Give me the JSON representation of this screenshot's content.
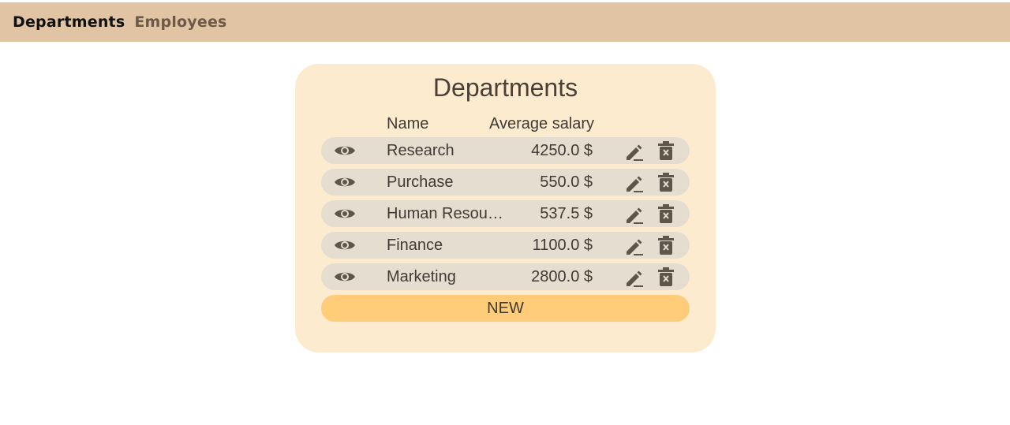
{
  "nav": {
    "items": [
      {
        "label": "Departments",
        "active": true
      },
      {
        "label": "Employees",
        "active": false
      }
    ]
  },
  "card": {
    "title": "Departments",
    "columns": {
      "name": "Name",
      "salary": "Average salary"
    },
    "rows": [
      {
        "name": "Research",
        "salary": "4250.0 $"
      },
      {
        "name": "Purchase",
        "salary": "550.0 $"
      },
      {
        "name": "Human Resources",
        "salary": "537.5 $"
      },
      {
        "name": "Finance",
        "salary": "1100.0 $"
      },
      {
        "name": "Marketing",
        "salary": "2800.0 $"
      }
    ],
    "new_label": "NEW"
  },
  "icons": {
    "view": "eye-icon",
    "edit": "pencil-icon",
    "delete": "trash-icon"
  },
  "colors": {
    "topbar": "#e0c4a4",
    "card": "#fdebd0",
    "row": "#e5ddcf",
    "new_button": "#ffcc7a",
    "icon": "#5e554b"
  }
}
